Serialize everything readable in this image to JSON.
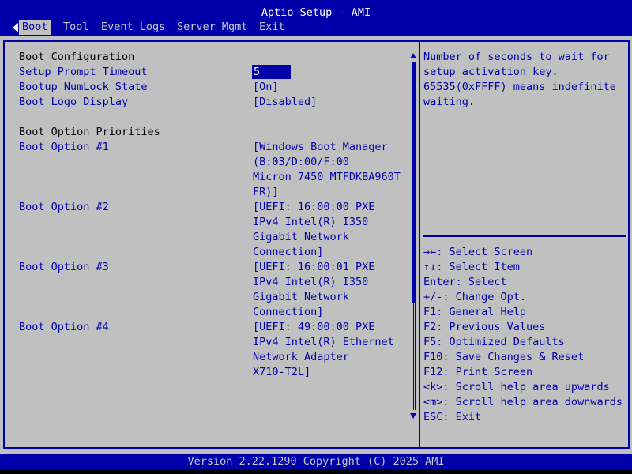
{
  "window": {
    "title": "Aptio Setup - AMI"
  },
  "tabs": [
    {
      "label": "Boot"
    },
    {
      "label": "Tool"
    },
    {
      "label": "Event Logs"
    },
    {
      "label": "Server Mgmt"
    },
    {
      "label": "Exit"
    }
  ],
  "settings": {
    "section_boot_config": "Boot Configuration",
    "setup_prompt_timeout": {
      "label": "Setup Prompt Timeout",
      "value": "5"
    },
    "bootup_numlock": {
      "label": "Bootup NumLock State",
      "value": "[On]"
    },
    "boot_logo": {
      "label": "Boot Logo Display",
      "value": "[Disabled]"
    },
    "section_priorities": "Boot Option Priorities",
    "boot_options": [
      {
        "label": "Boot Option #1",
        "lines": [
          "[Windows Boot Manager",
          "(B:03/D:00/F:00",
          "Micron_7450_MTFDKBA960T",
          "FR)]"
        ]
      },
      {
        "label": "Boot Option #2",
        "lines": [
          "[UEFI: 16:00:00 PXE",
          "IPv4 Intel(R) I350",
          "Gigabit Network",
          "Connection]"
        ]
      },
      {
        "label": "Boot Option #3",
        "lines": [
          "[UEFI: 16:00:01 PXE",
          "IPv4 Intel(R) I350",
          "Gigabit Network",
          "Connection]"
        ]
      },
      {
        "label": "Boot Option #4",
        "lines": [
          "[UEFI: 49:00:00 PXE",
          "IPv4 Intel(R) Ethernet",
          "Network Adapter",
          "X710-T2L]"
        ]
      }
    ]
  },
  "help": {
    "description": [
      "Number of seconds to wait for",
      "setup activation key.",
      "65535(0xFFFF) means indefinite",
      "waiting."
    ],
    "keys": [
      "→←: Select Screen",
      "↑↓: Select Item",
      "Enter: Select",
      "+/-: Change Opt.",
      "F1: General Help",
      "F2: Previous Values",
      "F5: Optimized Defaults",
      "F10: Save Changes & Reset",
      "F12: Print Screen",
      "<k>: Scroll help area upwards",
      "<m>: Scroll help area downwards",
      "ESC: Exit"
    ]
  },
  "footer": {
    "text": "Version 2.22.1290 Copyright (C) 2025 AMI"
  },
  "colors": {
    "background": "#c0c0c0",
    "accent": "#0000aa",
    "highlight_text": "#ffffff"
  }
}
